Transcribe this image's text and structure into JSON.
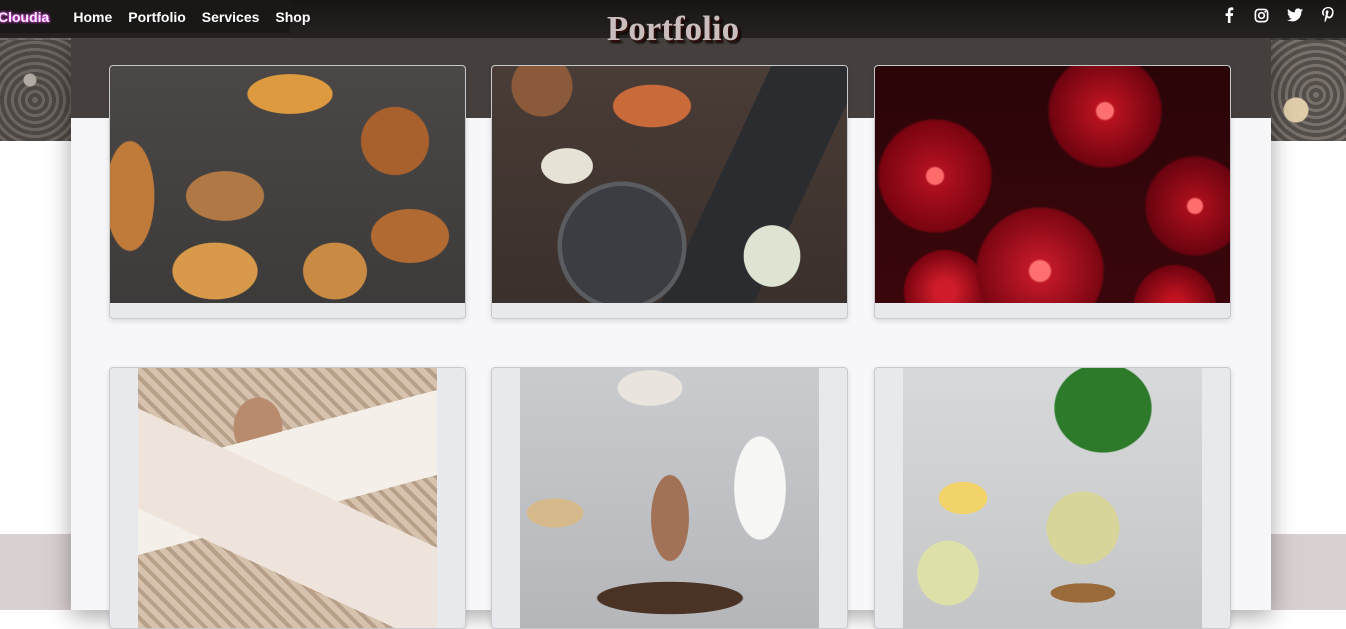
{
  "brand": {
    "name": "Cloudia"
  },
  "nav": {
    "items": [
      "Home",
      "Portfolio",
      "Services",
      "Shop"
    ]
  },
  "header": {
    "title": "Portfolio"
  },
  "social": [
    "facebook-icon",
    "instagram-icon",
    "twitter-icon",
    "pinterest-icon"
  ],
  "colors": {
    "navbar": "#1a1817",
    "panel_header": "#45403e",
    "panel": "#f7f7f9",
    "card": "#e7e9ec",
    "brand_glow": "#ff55ff"
  },
  "gallery": [
    {
      "subject": "pastries"
    },
    {
      "subject": "plated-feast"
    },
    {
      "subject": "cherries"
    },
    {
      "subject": "polaroid-photos"
    },
    {
      "subject": "chai-pour"
    },
    {
      "subject": "cocktail"
    }
  ]
}
